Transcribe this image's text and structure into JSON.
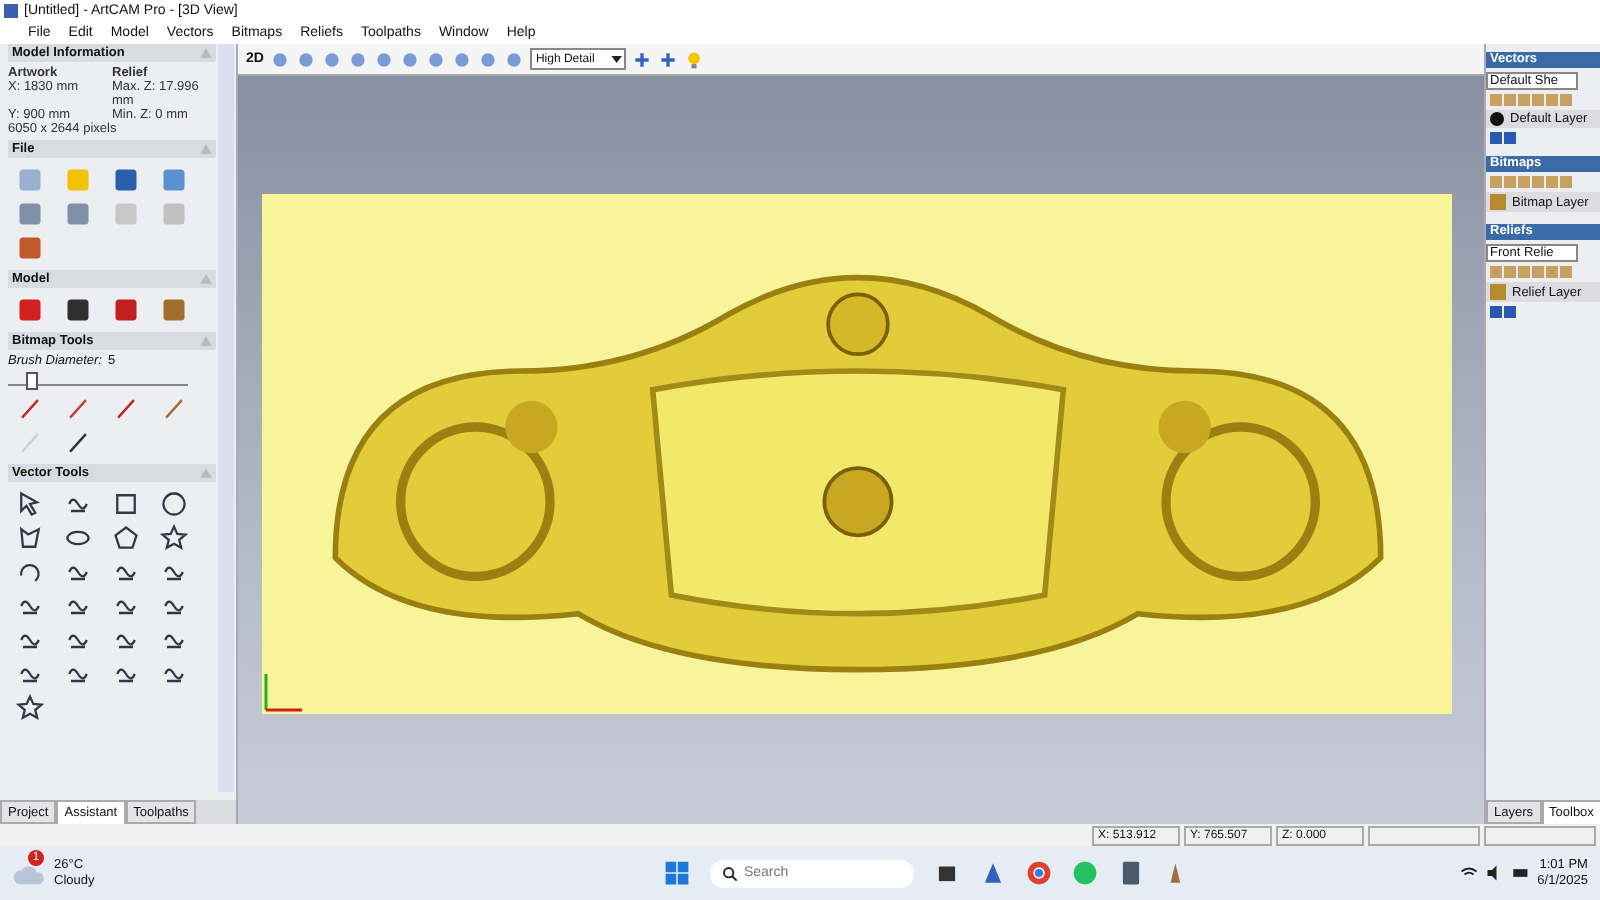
{
  "window": {
    "title": "[Untitled] - ArtCAM Pro - [3D View]"
  },
  "menu": [
    "File",
    "Edit",
    "Model",
    "Vectors",
    "Bitmaps",
    "Reliefs",
    "Toolpaths",
    "Window",
    "Help"
  ],
  "toolbar": {
    "mode_label": "2D",
    "detail": "High Detail"
  },
  "left_panel": {
    "model_info": {
      "header": "Model Information",
      "artwork_label": "Artwork",
      "relief_label": "Relief",
      "x": "X: 1830 mm",
      "max_z": "Max. Z: 17.996 mm",
      "y": "Y: 900 mm",
      "min_z": "Min. Z: 0 mm",
      "pixels": "6050 x 2644 pixels"
    },
    "file_header": "File",
    "model_header": "Model",
    "bitmap_tools_header": "Bitmap Tools",
    "brush_label": "Brush Diameter:",
    "brush_value": "5",
    "brush_slider": {
      "level": 0.1
    },
    "vector_tools_header": "Vector Tools",
    "tabs": [
      {
        "label": "Project",
        "selected": false
      },
      {
        "label": "Assistant",
        "selected": true
      },
      {
        "label": "Toolpaths",
        "selected": false
      }
    ]
  },
  "right_panel": {
    "vectors": {
      "header": "Vectors",
      "dropdown": "Default She",
      "layer": "Default Layer"
    },
    "bitmaps": {
      "header": "Bitmaps",
      "layer": "Bitmap Layer"
    },
    "reliefs": {
      "header": "Reliefs",
      "dropdown": "Front Relie",
      "layer": "Relief Layer"
    },
    "tabs": [
      {
        "label": "Layers",
        "selected": false
      },
      {
        "label": "Toolbox",
        "selected": true
      }
    ]
  },
  "status_bar": {
    "x": "X: 513.912",
    "y": "Y: 765.507",
    "z": "Z: 0.000"
  },
  "taskbar": {
    "weather_badge": "1",
    "temperature": "26°C",
    "condition": "Cloudy",
    "search": {
      "placeholder": "Search"
    },
    "time": "1:01 PM",
    "date": "6/1/2025"
  }
}
